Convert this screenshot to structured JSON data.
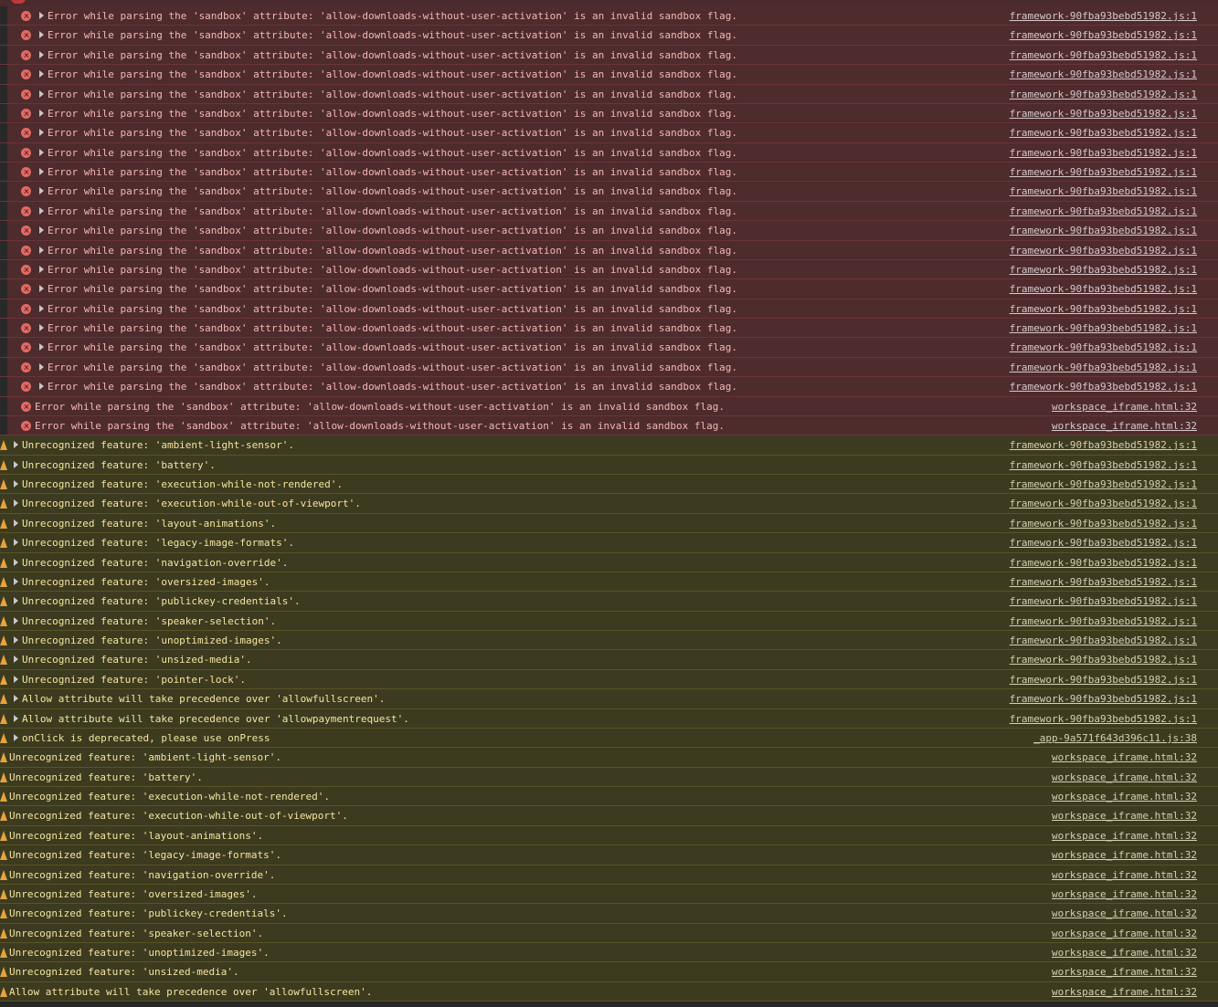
{
  "colors": {
    "background": "#282828",
    "error_row": "#4e2b2d",
    "warning_row": "#3c3a1f",
    "error_icon": "#e46962",
    "warning_icon": "#e8a33b"
  },
  "rows": [
    {
      "level": "error",
      "expandable": true,
      "indent": 1,
      "message": "Error while parsing the 'sandbox' attribute: 'allow-downloads-without-user-activation' is an invalid sandbox flag.",
      "source": "framework-90fba93bebd51982.js:1"
    },
    {
      "level": "error",
      "expandable": true,
      "indent": 1,
      "message": "Error while parsing the 'sandbox' attribute: 'allow-downloads-without-user-activation' is an invalid sandbox flag.",
      "source": "framework-90fba93bebd51982.js:1"
    },
    {
      "level": "error",
      "expandable": true,
      "indent": 1,
      "message": "Error while parsing the 'sandbox' attribute: 'allow-downloads-without-user-activation' is an invalid sandbox flag.",
      "source": "framework-90fba93bebd51982.js:1"
    },
    {
      "level": "error",
      "expandable": true,
      "indent": 1,
      "message": "Error while parsing the 'sandbox' attribute: 'allow-downloads-without-user-activation' is an invalid sandbox flag.",
      "source": "framework-90fba93bebd51982.js:1"
    },
    {
      "level": "error",
      "expandable": true,
      "indent": 1,
      "message": "Error while parsing the 'sandbox' attribute: 'allow-downloads-without-user-activation' is an invalid sandbox flag.",
      "source": "framework-90fba93bebd51982.js:1"
    },
    {
      "level": "error",
      "expandable": true,
      "indent": 1,
      "message": "Error while parsing the 'sandbox' attribute: 'allow-downloads-without-user-activation' is an invalid sandbox flag.",
      "source": "framework-90fba93bebd51982.js:1"
    },
    {
      "level": "error",
      "expandable": true,
      "indent": 1,
      "message": "Error while parsing the 'sandbox' attribute: 'allow-downloads-without-user-activation' is an invalid sandbox flag.",
      "source": "framework-90fba93bebd51982.js:1"
    },
    {
      "level": "error",
      "expandable": true,
      "indent": 1,
      "message": "Error while parsing the 'sandbox' attribute: 'allow-downloads-without-user-activation' is an invalid sandbox flag.",
      "source": "framework-90fba93bebd51982.js:1"
    },
    {
      "level": "error",
      "expandable": true,
      "indent": 1,
      "message": "Error while parsing the 'sandbox' attribute: 'allow-downloads-without-user-activation' is an invalid sandbox flag.",
      "source": "framework-90fba93bebd51982.js:1"
    },
    {
      "level": "error",
      "expandable": true,
      "indent": 1,
      "message": "Error while parsing the 'sandbox' attribute: 'allow-downloads-without-user-activation' is an invalid sandbox flag.",
      "source": "framework-90fba93bebd51982.js:1"
    },
    {
      "level": "error",
      "expandable": true,
      "indent": 1,
      "message": "Error while parsing the 'sandbox' attribute: 'allow-downloads-without-user-activation' is an invalid sandbox flag.",
      "source": "framework-90fba93bebd51982.js:1"
    },
    {
      "level": "error",
      "expandable": true,
      "indent": 1,
      "message": "Error while parsing the 'sandbox' attribute: 'allow-downloads-without-user-activation' is an invalid sandbox flag.",
      "source": "framework-90fba93bebd51982.js:1"
    },
    {
      "level": "error",
      "expandable": true,
      "indent": 1,
      "message": "Error while parsing the 'sandbox' attribute: 'allow-downloads-without-user-activation' is an invalid sandbox flag.",
      "source": "framework-90fba93bebd51982.js:1"
    },
    {
      "level": "error",
      "expandable": true,
      "indent": 1,
      "message": "Error while parsing the 'sandbox' attribute: 'allow-downloads-without-user-activation' is an invalid sandbox flag.",
      "source": "framework-90fba93bebd51982.js:1"
    },
    {
      "level": "error",
      "expandable": true,
      "indent": 1,
      "message": "Error while parsing the 'sandbox' attribute: 'allow-downloads-without-user-activation' is an invalid sandbox flag.",
      "source": "framework-90fba93bebd51982.js:1"
    },
    {
      "level": "error",
      "expandable": true,
      "indent": 1,
      "message": "Error while parsing the 'sandbox' attribute: 'allow-downloads-without-user-activation' is an invalid sandbox flag.",
      "source": "framework-90fba93bebd51982.js:1"
    },
    {
      "level": "error",
      "expandable": true,
      "indent": 1,
      "message": "Error while parsing the 'sandbox' attribute: 'allow-downloads-without-user-activation' is an invalid sandbox flag.",
      "source": "framework-90fba93bebd51982.js:1"
    },
    {
      "level": "error",
      "expandable": true,
      "indent": 1,
      "message": "Error while parsing the 'sandbox' attribute: 'allow-downloads-without-user-activation' is an invalid sandbox flag.",
      "source": "framework-90fba93bebd51982.js:1"
    },
    {
      "level": "error",
      "expandable": true,
      "indent": 1,
      "message": "Error while parsing the 'sandbox' attribute: 'allow-downloads-without-user-activation' is an invalid sandbox flag.",
      "source": "framework-90fba93bebd51982.js:1"
    },
    {
      "level": "error",
      "expandable": true,
      "indent": 1,
      "message": "Error while parsing the 'sandbox' attribute: 'allow-downloads-without-user-activation' is an invalid sandbox flag.",
      "source": "framework-90fba93bebd51982.js:1"
    },
    {
      "level": "error",
      "expandable": false,
      "indent": 1,
      "message": "Error while parsing the 'sandbox' attribute: 'allow-downloads-without-user-activation' is an invalid sandbox flag.",
      "source": "workspace_iframe.html:32"
    },
    {
      "level": "error",
      "expandable": false,
      "indent": 1,
      "message": "Error while parsing the 'sandbox' attribute: 'allow-downloads-without-user-activation' is an invalid sandbox flag.",
      "source": "workspace_iframe.html:32"
    },
    {
      "level": "warning",
      "expandable": true,
      "indent": 0,
      "message": "Unrecognized feature: 'ambient-light-sensor'.",
      "source": "framework-90fba93bebd51982.js:1"
    },
    {
      "level": "warning",
      "expandable": true,
      "indent": 0,
      "message": "Unrecognized feature: 'battery'.",
      "source": "framework-90fba93bebd51982.js:1"
    },
    {
      "level": "warning",
      "expandable": true,
      "indent": 0,
      "message": "Unrecognized feature: 'execution-while-not-rendered'.",
      "source": "framework-90fba93bebd51982.js:1"
    },
    {
      "level": "warning",
      "expandable": true,
      "indent": 0,
      "message": "Unrecognized feature: 'execution-while-out-of-viewport'.",
      "source": "framework-90fba93bebd51982.js:1"
    },
    {
      "level": "warning",
      "expandable": true,
      "indent": 0,
      "message": "Unrecognized feature: 'layout-animations'.",
      "source": "framework-90fba93bebd51982.js:1"
    },
    {
      "level": "warning",
      "expandable": true,
      "indent": 0,
      "message": "Unrecognized feature: 'legacy-image-formats'.",
      "source": "framework-90fba93bebd51982.js:1"
    },
    {
      "level": "warning",
      "expandable": true,
      "indent": 0,
      "message": "Unrecognized feature: 'navigation-override'.",
      "source": "framework-90fba93bebd51982.js:1"
    },
    {
      "level": "warning",
      "expandable": true,
      "indent": 0,
      "message": "Unrecognized feature: 'oversized-images'.",
      "source": "framework-90fba93bebd51982.js:1"
    },
    {
      "level": "warning",
      "expandable": true,
      "indent": 0,
      "message": "Unrecognized feature: 'publickey-credentials'.",
      "source": "framework-90fba93bebd51982.js:1"
    },
    {
      "level": "warning",
      "expandable": true,
      "indent": 0,
      "message": "Unrecognized feature: 'speaker-selection'.",
      "source": "framework-90fba93bebd51982.js:1"
    },
    {
      "level": "warning",
      "expandable": true,
      "indent": 0,
      "message": "Unrecognized feature: 'unoptimized-images'.",
      "source": "framework-90fba93bebd51982.js:1"
    },
    {
      "level": "warning",
      "expandable": true,
      "indent": 0,
      "message": "Unrecognized feature: 'unsized-media'.",
      "source": "framework-90fba93bebd51982.js:1"
    },
    {
      "level": "warning",
      "expandable": true,
      "indent": 0,
      "message": "Unrecognized feature: 'pointer-lock'.",
      "source": "framework-90fba93bebd51982.js:1"
    },
    {
      "level": "warning",
      "expandable": true,
      "indent": 0,
      "message": "Allow attribute will take precedence over 'allowfullscreen'.",
      "source": "framework-90fba93bebd51982.js:1"
    },
    {
      "level": "warning",
      "expandable": true,
      "indent": 0,
      "message": "Allow attribute will take precedence over 'allowpaymentrequest'.",
      "source": "framework-90fba93bebd51982.js:1"
    },
    {
      "level": "warning",
      "expandable": true,
      "indent": 0,
      "message": "onClick is deprecated, please use onPress",
      "source": "_app-9a571f643d396c11.js:38"
    },
    {
      "level": "warning",
      "expandable": false,
      "indent": 0,
      "message": "Unrecognized feature: 'ambient-light-sensor'.",
      "source": "workspace_iframe.html:32"
    },
    {
      "level": "warning",
      "expandable": false,
      "indent": 0,
      "message": "Unrecognized feature: 'battery'.",
      "source": "workspace_iframe.html:32"
    },
    {
      "level": "warning",
      "expandable": false,
      "indent": 0,
      "message": "Unrecognized feature: 'execution-while-not-rendered'.",
      "source": "workspace_iframe.html:32"
    },
    {
      "level": "warning",
      "expandable": false,
      "indent": 0,
      "message": "Unrecognized feature: 'execution-while-out-of-viewport'.",
      "source": "workspace_iframe.html:32"
    },
    {
      "level": "warning",
      "expandable": false,
      "indent": 0,
      "message": "Unrecognized feature: 'layout-animations'.",
      "source": "workspace_iframe.html:32"
    },
    {
      "level": "warning",
      "expandable": false,
      "indent": 0,
      "message": "Unrecognized feature: 'legacy-image-formats'.",
      "source": "workspace_iframe.html:32"
    },
    {
      "level": "warning",
      "expandable": false,
      "indent": 0,
      "message": "Unrecognized feature: 'navigation-override'.",
      "source": "workspace_iframe.html:32"
    },
    {
      "level": "warning",
      "expandable": false,
      "indent": 0,
      "message": "Unrecognized feature: 'oversized-images'.",
      "source": "workspace_iframe.html:32"
    },
    {
      "level": "warning",
      "expandable": false,
      "indent": 0,
      "message": "Unrecognized feature: 'publickey-credentials'.",
      "source": "workspace_iframe.html:32"
    },
    {
      "level": "warning",
      "expandable": false,
      "indent": 0,
      "message": "Unrecognized feature: 'speaker-selection'.",
      "source": "workspace_iframe.html:32"
    },
    {
      "level": "warning",
      "expandable": false,
      "indent": 0,
      "message": "Unrecognized feature: 'unoptimized-images'.",
      "source": "workspace_iframe.html:32"
    },
    {
      "level": "warning",
      "expandable": false,
      "indent": 0,
      "message": "Unrecognized feature: 'unsized-media'.",
      "source": "workspace_iframe.html:32"
    },
    {
      "level": "warning",
      "expandable": false,
      "indent": 0,
      "message": "Allow attribute will take precedence over 'allowfullscreen'.",
      "source": "workspace_iframe.html:32"
    }
  ]
}
